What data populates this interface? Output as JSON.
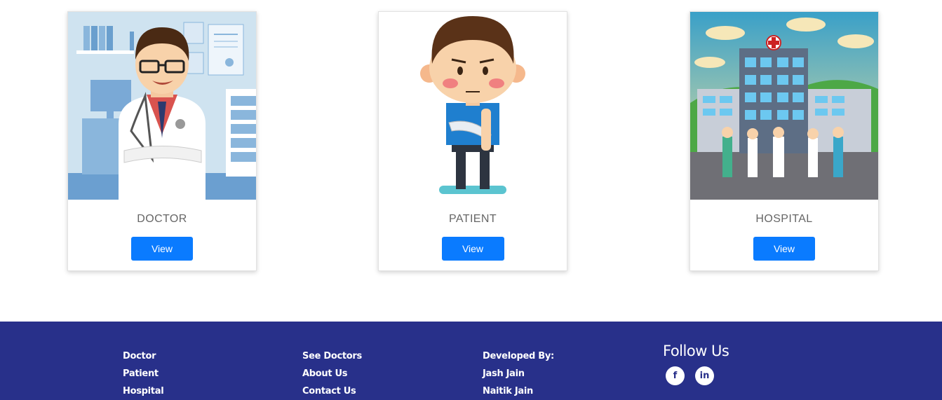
{
  "cards": [
    {
      "title": "DOCTOR",
      "button": "View"
    },
    {
      "title": "PATIENT",
      "button": "View"
    },
    {
      "title": "HOSPITAL",
      "button": "View"
    }
  ],
  "footer": {
    "col1": [
      "Doctor",
      "Patient",
      "Hospital"
    ],
    "col2": [
      "See Doctors",
      "About Us",
      "Contact Us"
    ],
    "col3": [
      "Developed By:",
      "Jash Jain",
      "Naitik Jain"
    ],
    "follow_title": "Follow Us",
    "socials": [
      {
        "icon": "facebook-icon",
        "glyph": "f"
      },
      {
        "icon": "linkedin-icon",
        "glyph": "in"
      }
    ]
  },
  "colors": {
    "footer_bg": "#28308a",
    "button_bg": "#0a7bff",
    "card_title": "#666666"
  }
}
